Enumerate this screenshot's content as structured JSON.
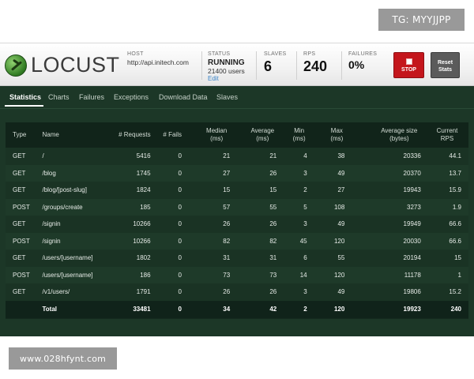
{
  "watermark_top": "TG: MYYJJPP",
  "watermark_bottom": "www.028hfynt.com",
  "logo": {
    "text": "LOCUST"
  },
  "header": {
    "host": {
      "label": "HOST",
      "value": "http://api.initech.com"
    },
    "status": {
      "label": "STATUS",
      "value": "RUNNING",
      "users": "21400 users",
      "edit": "Edit"
    },
    "slaves": {
      "label": "SLAVES",
      "value": "6"
    },
    "rps": {
      "label": "RPS",
      "value": "240"
    },
    "failures": {
      "label": "FAILURES",
      "value": "0%"
    },
    "stop_label": "STOP",
    "reset_label": "Reset Stats"
  },
  "tabs": [
    "Statistics",
    "Charts",
    "Failures",
    "Exceptions",
    "Download Data",
    "Slaves"
  ],
  "table": {
    "headers": [
      "Type",
      "Name",
      "# Requests",
      "# Fails",
      "Median (ms)",
      "Average (ms)",
      "Min (ms)",
      "Max (ms)",
      "Average size (bytes)",
      "Current RPS"
    ],
    "rows": [
      [
        "GET",
        "/",
        "5416",
        "0",
        "21",
        "21",
        "4",
        "38",
        "20336",
        "44.1"
      ],
      [
        "GET",
        "/blog",
        "1745",
        "0",
        "27",
        "26",
        "3",
        "49",
        "20370",
        "13.7"
      ],
      [
        "GET",
        "/blog/[post-slug]",
        "1824",
        "0",
        "15",
        "15",
        "2",
        "27",
        "19943",
        "15.9"
      ],
      [
        "POST",
        "/groups/create",
        "185",
        "0",
        "57",
        "55",
        "5",
        "108",
        "3273",
        "1.9"
      ],
      [
        "GET",
        "/signin",
        "10266",
        "0",
        "26",
        "26",
        "3",
        "49",
        "19949",
        "66.6"
      ],
      [
        "POST",
        "/signin",
        "10266",
        "0",
        "82",
        "82",
        "45",
        "120",
        "20030",
        "66.6"
      ],
      [
        "GET",
        "/users/[username]",
        "1802",
        "0",
        "31",
        "31",
        "6",
        "55",
        "20194",
        "15"
      ],
      [
        "POST",
        "/users/[username]",
        "186",
        "0",
        "73",
        "73",
        "14",
        "120",
        "11178",
        "1"
      ],
      [
        "GET",
        "/v1/users/",
        "1791",
        "0",
        "26",
        "26",
        "3",
        "49",
        "19806",
        "15.2"
      ]
    ],
    "total": [
      "",
      "Total",
      "33481",
      "0",
      "34",
      "42",
      "2",
      "120",
      "19923",
      "240"
    ]
  }
}
